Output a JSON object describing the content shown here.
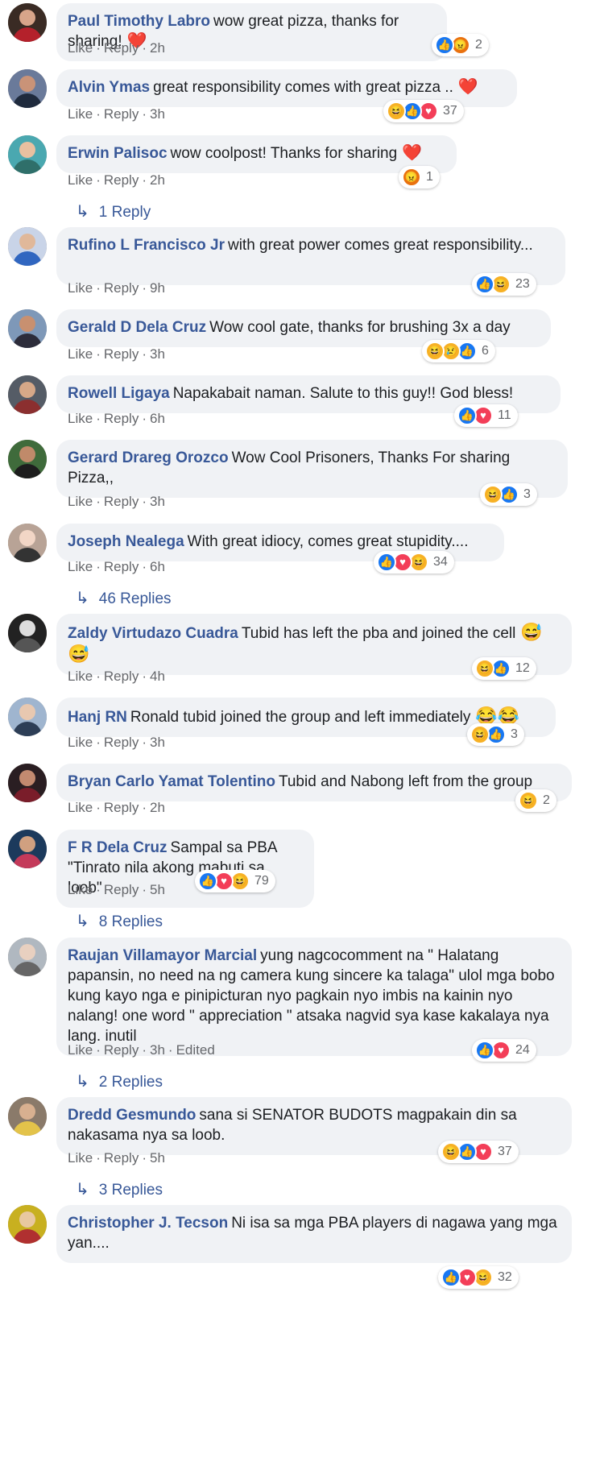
{
  "ui": {
    "like_label": "Like",
    "reply_label": "Reply",
    "edited_label": "Edited",
    "colors": {
      "author": "#385898",
      "bubble": "#f0f2f5",
      "meta": "#65676b",
      "like": "#1877f2",
      "love": "#f33e58",
      "haha": "#f7b125",
      "angry": "#e9710f"
    }
  },
  "comments": [
    {
      "author": "Paul Timothy Labro",
      "text": "wow great pizza, thanks for sharing!",
      "emoji": "❤️",
      "time": "2h",
      "reactions": [
        "like",
        "angry"
      ],
      "count": "2",
      "replies": ""
    },
    {
      "author": "Alvin Ymas",
      "text": "great responsibility comes with great pizza ..",
      "emoji": "❤️",
      "time": "3h",
      "reactions": [
        "haha",
        "like",
        "love"
      ],
      "count": "37",
      "replies": ""
    },
    {
      "author": "Erwin Palisoc",
      "text": "wow coolpost! Thanks for sharing",
      "emoji": "❤️",
      "time": "2h",
      "reactions": [
        "angry"
      ],
      "count": "1",
      "replies": "1 Reply"
    },
    {
      "author": "Rufino L Francisco Jr",
      "text": "with great power comes great responsibility...",
      "emoji": "",
      "time": "9h",
      "reactions": [
        "like",
        "haha"
      ],
      "count": "23",
      "replies": ""
    },
    {
      "author": "Gerald D Dela Cruz",
      "text": "Wow cool gate, thanks for brushing 3x a day",
      "emoji": "",
      "time": "3h",
      "reactions": [
        "haha",
        "sad",
        "like"
      ],
      "count": "6",
      "replies": ""
    },
    {
      "author": "Rowell Ligaya",
      "text": "Napakabait naman. Salute to this guy!! God bless!",
      "emoji": "",
      "time": "6h",
      "reactions": [
        "like",
        "love"
      ],
      "count": "11",
      "replies": ""
    },
    {
      "author": "Gerard Drareg Orozco",
      "text": "Wow Cool Prisoners, Thanks For sharing Pizza,,",
      "emoji": "",
      "time": "3h",
      "reactions": [
        "haha",
        "like"
      ],
      "count": "3",
      "replies": ""
    },
    {
      "author": "Joseph Nealega",
      "text": "With great idiocy, comes great stupidity....",
      "emoji": "",
      "time": "6h",
      "reactions": [
        "like",
        "love",
        "haha"
      ],
      "count": "34",
      "replies": "46 Replies"
    },
    {
      "author": "Zaldy Virtudazo Cuadra",
      "text": "Tubid has left the pba and joined the cell",
      "emoji": "😅😅",
      "time": "4h",
      "reactions": [
        "haha",
        "like"
      ],
      "count": "12",
      "replies": ""
    },
    {
      "author": "Hanj RN",
      "text": "Ronald tubid joined the group and left immediately",
      "emoji": "😂😂",
      "time": "3h",
      "reactions": [
        "haha",
        "like"
      ],
      "count": "3",
      "replies": ""
    },
    {
      "author": "Bryan Carlo Yamat Tolentino",
      "text": "Tubid and Nabong left from the group",
      "emoji": "",
      "time": "2h",
      "reactions": [
        "haha"
      ],
      "count": "2",
      "replies": ""
    },
    {
      "author": "F R Dela Cruz",
      "text": "Sampal sa PBA \"Tinrato nila akong mabuti sa loob\"",
      "emoji": "",
      "time": "5h",
      "reactions": [
        "like",
        "love",
        "haha"
      ],
      "count": "79",
      "replies": "8 Replies"
    },
    {
      "author": "Raujan Villamayor Marcial",
      "text": "yung nagcocomment na \" Halatang papansin, no need na ng camera kung sincere ka talaga\" ulol mga bobo kung kayo nga e pinipicturan nyo pagkain nyo imbis na kainin nyo nalang! one word \" appreciation \" atsaka nagvid sya kase kakalaya nya lang. inutil",
      "emoji": "",
      "time": "3h",
      "edited": true,
      "reactions": [
        "like",
        "love"
      ],
      "count": "24",
      "replies": "2 Replies"
    },
    {
      "author": "Dredd Gesmundo",
      "text": "sana si SENATOR BUDOTS magpakain din sa nakasama nya sa loob.",
      "emoji": "",
      "time": "5h",
      "reactions": [
        "haha",
        "like",
        "love"
      ],
      "count": "37",
      "replies": "3 Replies"
    },
    {
      "author": "Christopher J. Tecson",
      "text": "Ni isa sa mga PBA players di nagawa yang mga yan....",
      "emoji": "",
      "time": "",
      "reactions": [
        "like",
        "love",
        "haha"
      ],
      "count": "32",
      "replies": ""
    }
  ]
}
